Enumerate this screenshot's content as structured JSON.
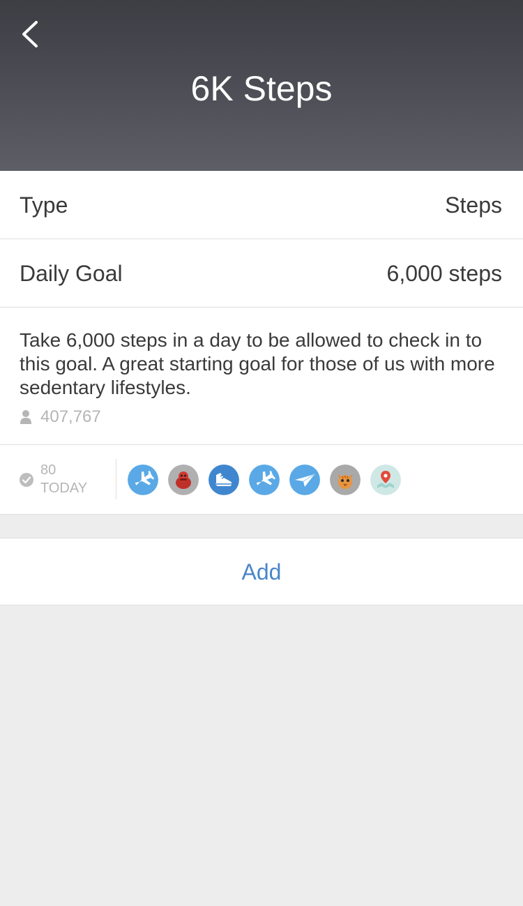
{
  "header": {
    "title": "6K Steps",
    "back_icon": "chevron-left-icon"
  },
  "details": {
    "type_label": "Type",
    "type_value": "Steps",
    "goal_label": "Daily Goal",
    "goal_value": "6,000 steps",
    "description": "Take 6,000 steps in a day to be allowed to check in to this goal.  A great starting goal for those of us with more sedentary lifestyles.",
    "members_icon": "person-icon",
    "members_count": "407,767"
  },
  "checkins": {
    "check_icon": "checkmark-circle-icon",
    "today_count": "80",
    "today_label": "TODAY",
    "avatars": [
      {
        "icon": "airplane-avatar",
        "color": "#5aa9e6"
      },
      {
        "icon": "red-toy-avatar",
        "color": "#b0b0b0"
      },
      {
        "icon": "sneaker-avatar",
        "color": "#3f86cf"
      },
      {
        "icon": "airplane-avatar",
        "color": "#5aa9e6"
      },
      {
        "icon": "paper-plane-avatar",
        "color": "#5aa9e6"
      },
      {
        "icon": "cat-avatar",
        "color": "#a9a9a9"
      },
      {
        "icon": "map-pin-avatar",
        "color": "#cfe8e6"
      }
    ]
  },
  "actions": {
    "add_label": "Add"
  },
  "colors": {
    "header_top": "#3d3d44",
    "header_bottom": "#5e5e66",
    "accent_blue": "#4a86c8",
    "background": "#ededed"
  }
}
